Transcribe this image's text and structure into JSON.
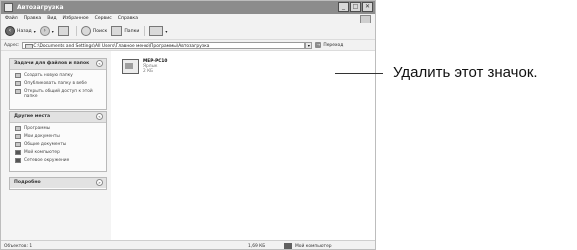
{
  "window": {
    "title": "Автозагрузка"
  },
  "menu": [
    "Файл",
    "Правка",
    "Вид",
    "Избранное",
    "Сервис",
    "Справка"
  ],
  "toolbar": {
    "back": "Назад",
    "search": "Поиск",
    "folders": "Папки"
  },
  "address": {
    "label": "Адрес:",
    "path": "C:\\Documents and Settings\\All Users\\Главное меню\\Программы\\Автозагрузка",
    "go": "Переход"
  },
  "panels": {
    "tasks": {
      "title": "Задачи для файлов и папок",
      "links": [
        "Создать новую папку",
        "Опубликовать папку в вебе",
        "Открыть общий доступ к этой папке"
      ]
    },
    "places": {
      "title": "Другие места",
      "links": [
        "Программы",
        "Мои документы",
        "Общие документы",
        "Мой компьютер",
        "Сетевое окружение"
      ]
    },
    "details": {
      "title": "Подробно"
    }
  },
  "file": {
    "name": "MEP-PC10",
    "type": "Ярлык",
    "size": "2 КБ"
  },
  "status": {
    "objects": "Объектов: 1",
    "size": "1,69 КБ",
    "location": "Мой компьютер"
  },
  "callout": {
    "text": "Удалить этот значок."
  }
}
